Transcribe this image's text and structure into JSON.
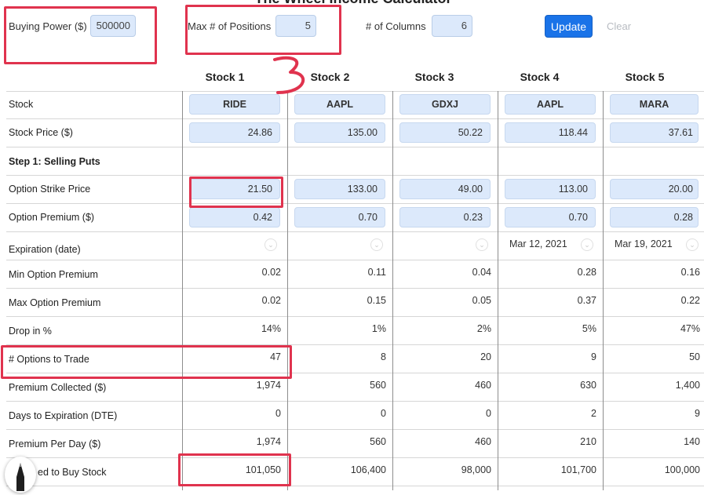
{
  "app": {
    "title": "The Wheel Income Calculator"
  },
  "controls": {
    "buying_power_label": "Buying Power ($)",
    "buying_power_value": "500000",
    "max_positions_label": "Max # of Positions",
    "max_positions_value": "5",
    "num_columns_label": "# of Columns",
    "num_columns_value": "6",
    "update_label": "Update",
    "clear_label": "Clear"
  },
  "table": {
    "stock_headers": [
      "Stock 1",
      "Stock 2",
      "Stock 3",
      "Stock 4",
      "Stock 5"
    ],
    "section_step1": "Step 1: Selling Puts",
    "row_labels": {
      "stock": "Stock",
      "stock_price": "Stock Price ($)",
      "strike": "Option Strike Price",
      "premium": "Option Premium ($)",
      "expiration": "Expiration (date)",
      "min_premium": "Min Option Premium",
      "max_premium": "Max Option Premium",
      "drop": "Drop in %",
      "options_to_trade": "# Options to Trade",
      "premium_collected": "Premium Collected ($)",
      "dte": "Days to Expiration (DTE)",
      "premium_per_day": "Premium Per Day ($)",
      "needed_to_buy": "ed to Buy Stock"
    },
    "columns": [
      {
        "stock": "RIDE",
        "stock_price": "24.86",
        "strike": "21.50",
        "premium": "0.42",
        "expiration": "",
        "min_premium": "0.02",
        "max_premium": "0.02",
        "drop": "14%",
        "options_to_trade": "47",
        "premium_collected": "1,974",
        "dte": "0",
        "premium_per_day": "1,974",
        "needed_to_buy": "101,050"
      },
      {
        "stock": "AAPL",
        "stock_price": "135.00",
        "strike": "133.00",
        "premium": "0.70",
        "expiration": "",
        "min_premium": "0.11",
        "max_premium": "0.15",
        "drop": "1%",
        "options_to_trade": "8",
        "premium_collected": "560",
        "dte": "0",
        "premium_per_day": "560",
        "needed_to_buy": "106,400"
      },
      {
        "stock": "GDXJ",
        "stock_price": "50.22",
        "strike": "49.00",
        "premium": "0.23",
        "expiration": "",
        "min_premium": "0.04",
        "max_premium": "0.05",
        "drop": "2%",
        "options_to_trade": "20",
        "premium_collected": "460",
        "dte": "0",
        "premium_per_day": "460",
        "needed_to_buy": "98,000"
      },
      {
        "stock": "AAPL",
        "stock_price": "118.44",
        "strike": "113.00",
        "premium": "0.70",
        "expiration": "Mar 12, 2021",
        "min_premium": "0.28",
        "max_premium": "0.37",
        "drop": "5%",
        "options_to_trade": "9",
        "premium_collected": "630",
        "dte": "2",
        "premium_per_day": "210",
        "needed_to_buy": "101,700"
      },
      {
        "stock": "MARA",
        "stock_price": "37.61",
        "strike": "20.00",
        "premium": "0.28",
        "expiration": "Mar 19, 2021",
        "min_premium": "0.16",
        "max_premium": "0.22",
        "drop": "47%",
        "options_to_trade": "50",
        "premium_collected": "1,400",
        "dte": "9",
        "premium_per_day": "140",
        "needed_to_buy": "100,000"
      }
    ]
  },
  "annotations": {
    "handwritten_number": "3"
  },
  "colors": {
    "accent": "#1a73e8",
    "input_bg": "#dce9fb",
    "annotation_red": "#e0334e"
  },
  "icons": {
    "dropdown": "chevron-down-icon",
    "pen": "pencil-icon"
  }
}
